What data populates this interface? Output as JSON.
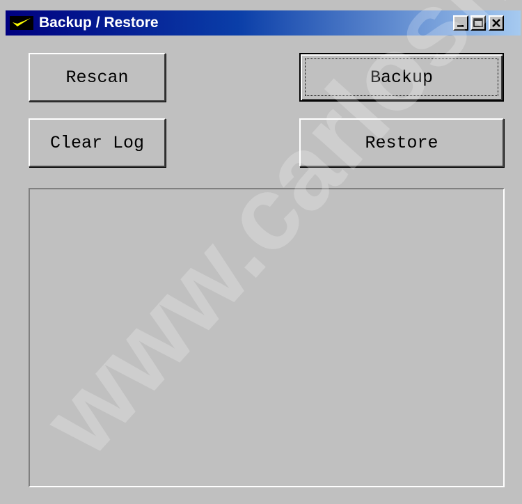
{
  "window": {
    "title": "Backup / Restore",
    "app_icon": "checkmark-icon",
    "controls": [
      "minimize-icon",
      "maximize-icon",
      "close-icon"
    ]
  },
  "buttons": {
    "rescan": "Rescan",
    "backup": "Backup",
    "clear_log": "Clear Log",
    "restore": "Restore"
  },
  "log": {
    "text": ""
  },
  "watermark": "www.carlosn",
  "colors": {
    "face": "#c0c0c0",
    "title_start": "#000080",
    "title_end": "#a6caf0",
    "app_icon": "#ffff00"
  }
}
